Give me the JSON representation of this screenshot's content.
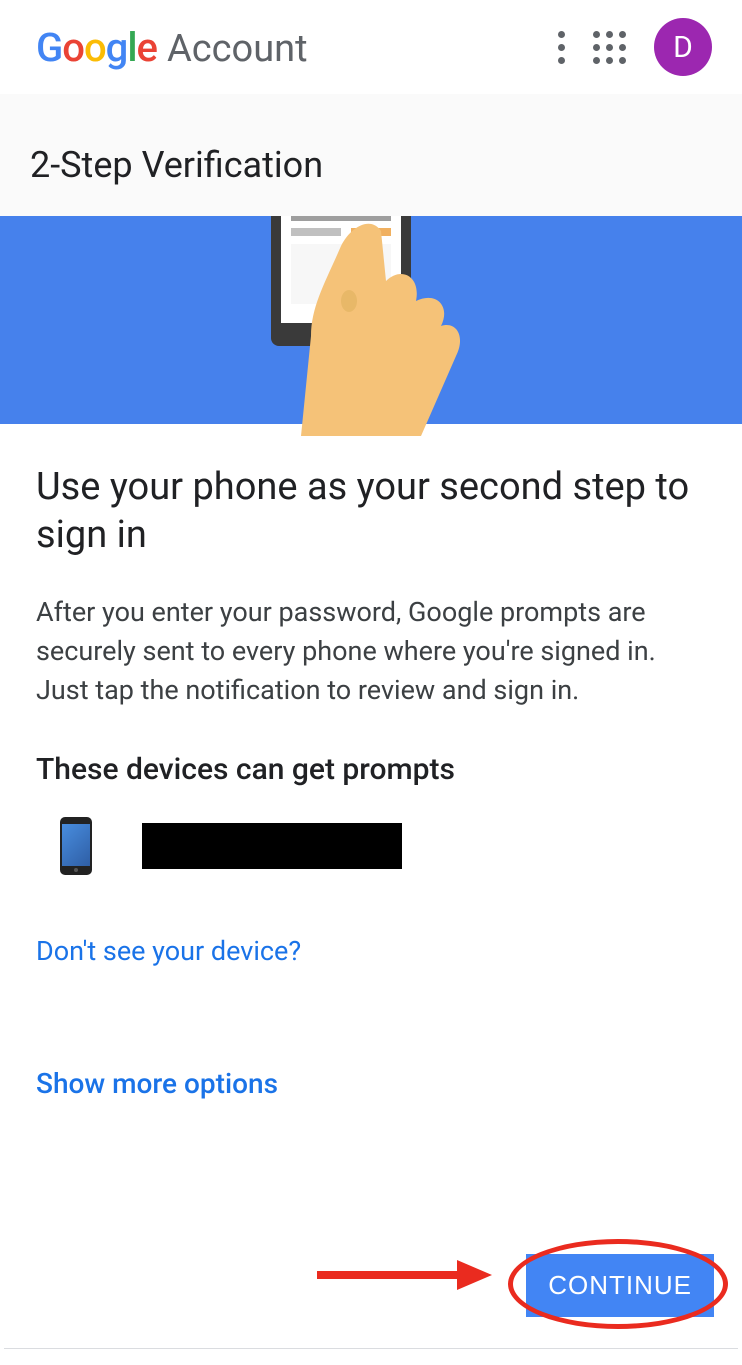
{
  "header": {
    "logo_account_text": "Account",
    "avatar_letter": "D"
  },
  "page": {
    "title": "2-Step Verification"
  },
  "main": {
    "heading": "Use your phone as your second step to sign in",
    "description": "After you enter your password, Google prompts are securely sent to every phone where you're signed in. Just tap the notification to review and sign in.",
    "devices_heading": "These devices can get prompts",
    "device_name_redacted": true,
    "link_no_device": "Don't see your device?",
    "link_more_options": "Show more options",
    "continue_label": "CONTINUE"
  },
  "annotation": {
    "arrow_color": "#EA2B1F",
    "ellipse_color": "#EA2B1F"
  }
}
